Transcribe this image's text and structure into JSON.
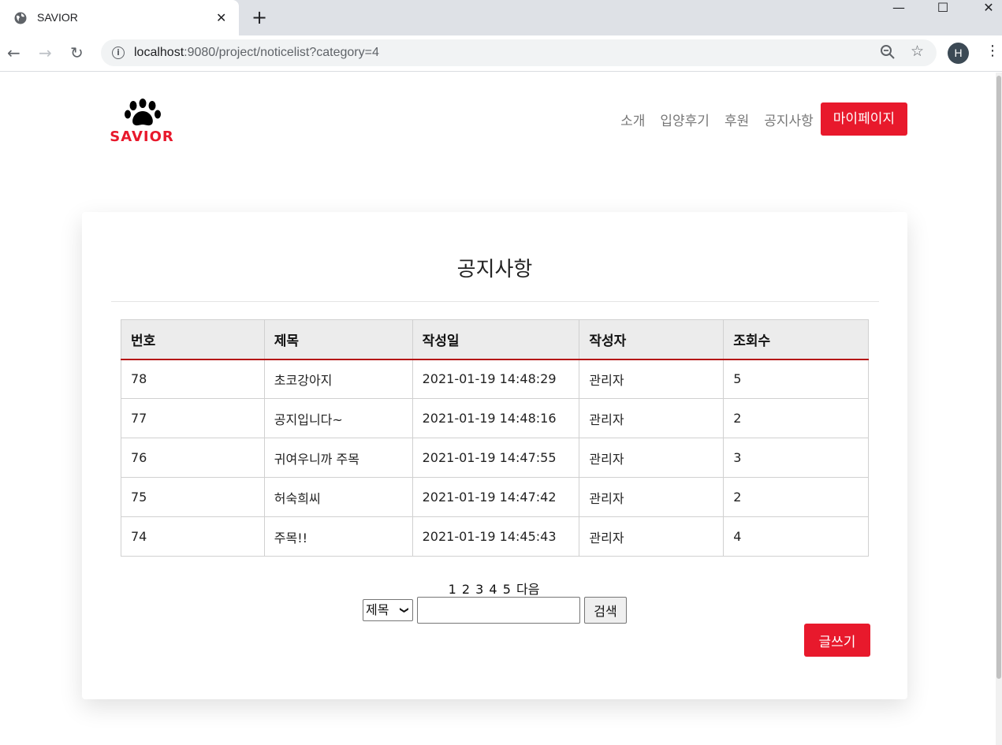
{
  "browser": {
    "tab_title": "SAVIOR",
    "tab_close": "✕",
    "new_tab": "+",
    "url_host": "localhost",
    "url_rest": ":9080/project/noticelist?category=4",
    "avatar_letter": "H",
    "win_minimize": "—",
    "win_maximize": "☐",
    "win_close": "✕"
  },
  "site": {
    "logo_text": "SAVIOR",
    "brand_color": "#e8192c",
    "nav": [
      "소개",
      "입양후기",
      "후원",
      "공지사항"
    ],
    "nav_cta": "마이페이지"
  },
  "board": {
    "title": "공지사항",
    "columns": [
      "번호",
      "제목",
      "작성일",
      "작성자",
      "조회수"
    ],
    "rows": [
      {
        "no": "78",
        "title": "초코강아지",
        "date": "2021-01-19 14:48:29",
        "author": "관리자",
        "views": "5"
      },
      {
        "no": "77",
        "title": "공지입니다~",
        "date": "2021-01-19 14:48:16",
        "author": "관리자",
        "views": "2"
      },
      {
        "no": "76",
        "title": "귀여우니까 주목",
        "date": "2021-01-19 14:47:55",
        "author": "관리자",
        "views": "3"
      },
      {
        "no": "75",
        "title": "허숙희씨",
        "date": "2021-01-19 14:47:42",
        "author": "관리자",
        "views": "2"
      },
      {
        "no": "74",
        "title": "주목!!",
        "date": "2021-01-19 14:45:43",
        "author": "관리자",
        "views": "4"
      }
    ],
    "pages": [
      "1",
      "2",
      "3",
      "4",
      "5"
    ],
    "next_label": "다음",
    "search_field": "제목",
    "search_button": "검색",
    "write_button": "글쓰기"
  }
}
